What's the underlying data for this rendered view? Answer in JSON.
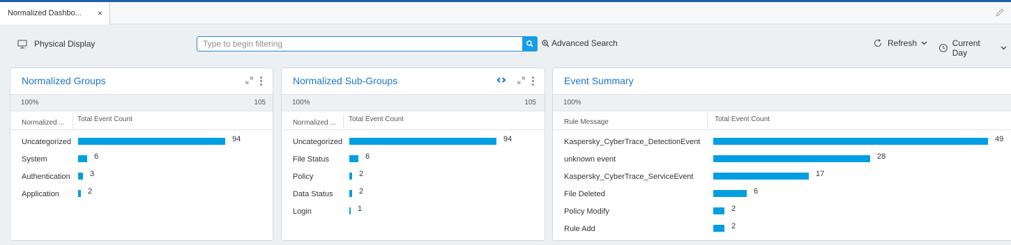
{
  "tab": {
    "label": "Normalized Dashbo...",
    "close": "×"
  },
  "toolbar": {
    "physical_display": "Physical Display",
    "filter_placeholder": "Type to begin filtering",
    "advanced_search": "Advanced Search",
    "refresh": "Refresh",
    "current_day": "Current Day"
  },
  "colors": {
    "accent": "#1f77c5",
    "bar": "#009fe3",
    "search_button": "#1a9be6",
    "top_line": "#1f5fa8"
  },
  "panels": [
    {
      "title": "Normalized Groups",
      "summary_pct": "100%",
      "summary_total": "105",
      "col1": "Normalized ...",
      "col2": "Total Event Count",
      "max": 94,
      "rows": [
        {
          "label": "Uncategorized",
          "value": 94
        },
        {
          "label": "System",
          "value": 6
        },
        {
          "label": "Authentication",
          "value": 3
        },
        {
          "label": "Application",
          "value": 2
        }
      ]
    },
    {
      "title": "Normalized Sub-Groups",
      "summary_pct": "100%",
      "summary_total": "105",
      "col1": "Normalized ...",
      "col2": "Total Event Count",
      "max": 94,
      "rows": [
        {
          "label": "Uncategorized",
          "value": 94
        },
        {
          "label": "File Status",
          "value": 6
        },
        {
          "label": "Policy",
          "value": 2
        },
        {
          "label": "Data Status",
          "value": 2
        },
        {
          "label": "Login",
          "value": 1
        }
      ]
    },
    {
      "title": "Event Summary",
      "summary_pct": "100%",
      "summary_total": "",
      "col1": "Rule Message",
      "col2": "Total Event Count",
      "max": 49,
      "rows": [
        {
          "label": "Kaspersky_CyberTrace_DetectionEvent",
          "value": 49
        },
        {
          "label": "unknown event",
          "value": 28
        },
        {
          "label": "Kaspersky_CyberTrace_ServiceEvent",
          "value": 17
        },
        {
          "label": "File Deleted",
          "value": 6
        },
        {
          "label": "Policy Modify",
          "value": 2
        },
        {
          "label": "Rule Add",
          "value": 2
        }
      ]
    }
  ]
}
